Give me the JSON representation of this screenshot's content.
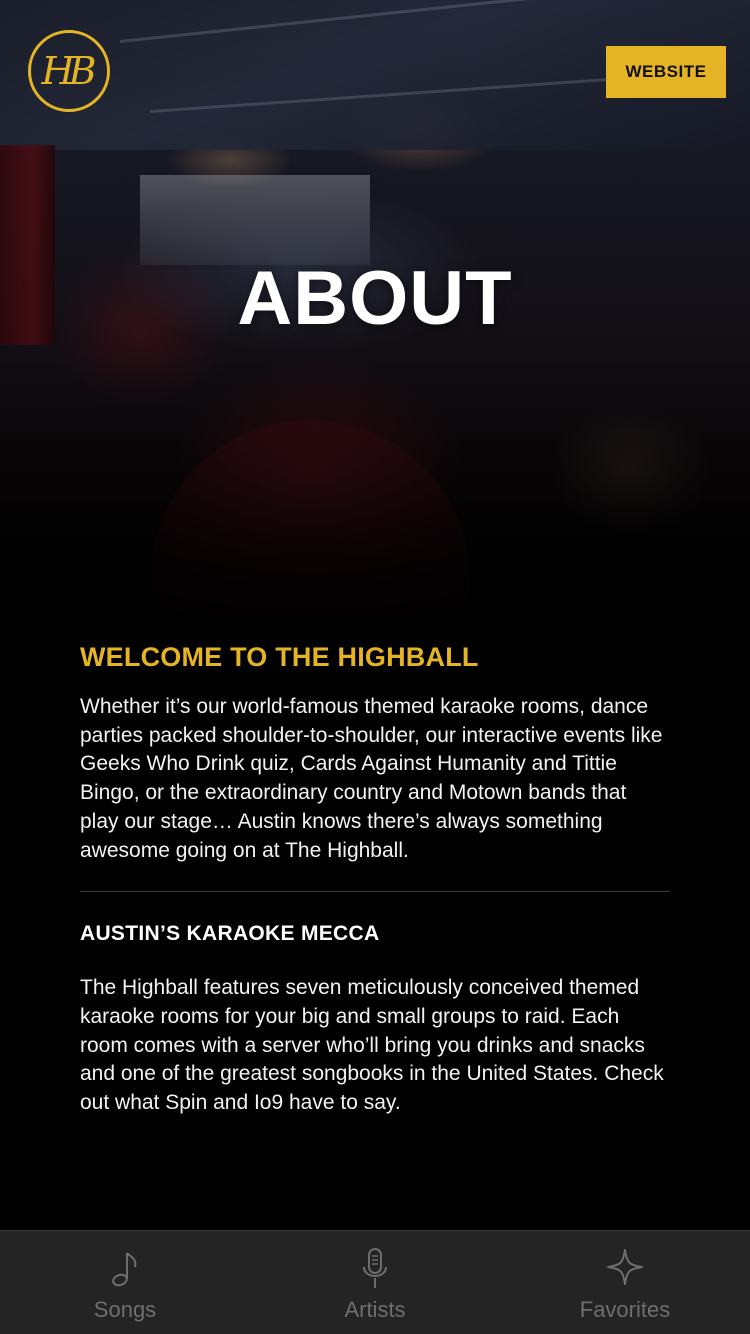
{
  "header": {
    "logo_text": "HB",
    "website_label": "WEBSITE",
    "hero_title": "ABOUT"
  },
  "content": {
    "welcome_title": "WELCOME TO THE HIGHBALL",
    "welcome_text": "Whether it’s our world-famous themed karaoke rooms, dance parties packed shoulder-to-shoulder, our interactive events like Geeks Who Drink quiz, Cards Against Humanity and Tittie Bingo, or the extraordinary country and Motown bands that play our stage… Austin knows there’s always something awesome going on at The Highball.",
    "section_title": "AUSTIN’S KARAOKE MECCA",
    "section_text": "The Highball features seven meticulously conceived themed karaoke rooms for your big and small groups to raid. Each room comes with a server who’ll bring you drinks and snacks and one of the greatest songbooks in the United States. Check out what Spin and Io9 have to say."
  },
  "tabbar": {
    "tabs": [
      {
        "label": "Songs",
        "icon": "music-note-icon"
      },
      {
        "label": "Artists",
        "icon": "microphone-icon"
      },
      {
        "label": "Favorites",
        "icon": "star-icon"
      }
    ]
  },
  "colors": {
    "accent": "#e5b424",
    "background": "#000000",
    "tabbar": "#242424",
    "tab_inactive": "#6e6e6e"
  }
}
